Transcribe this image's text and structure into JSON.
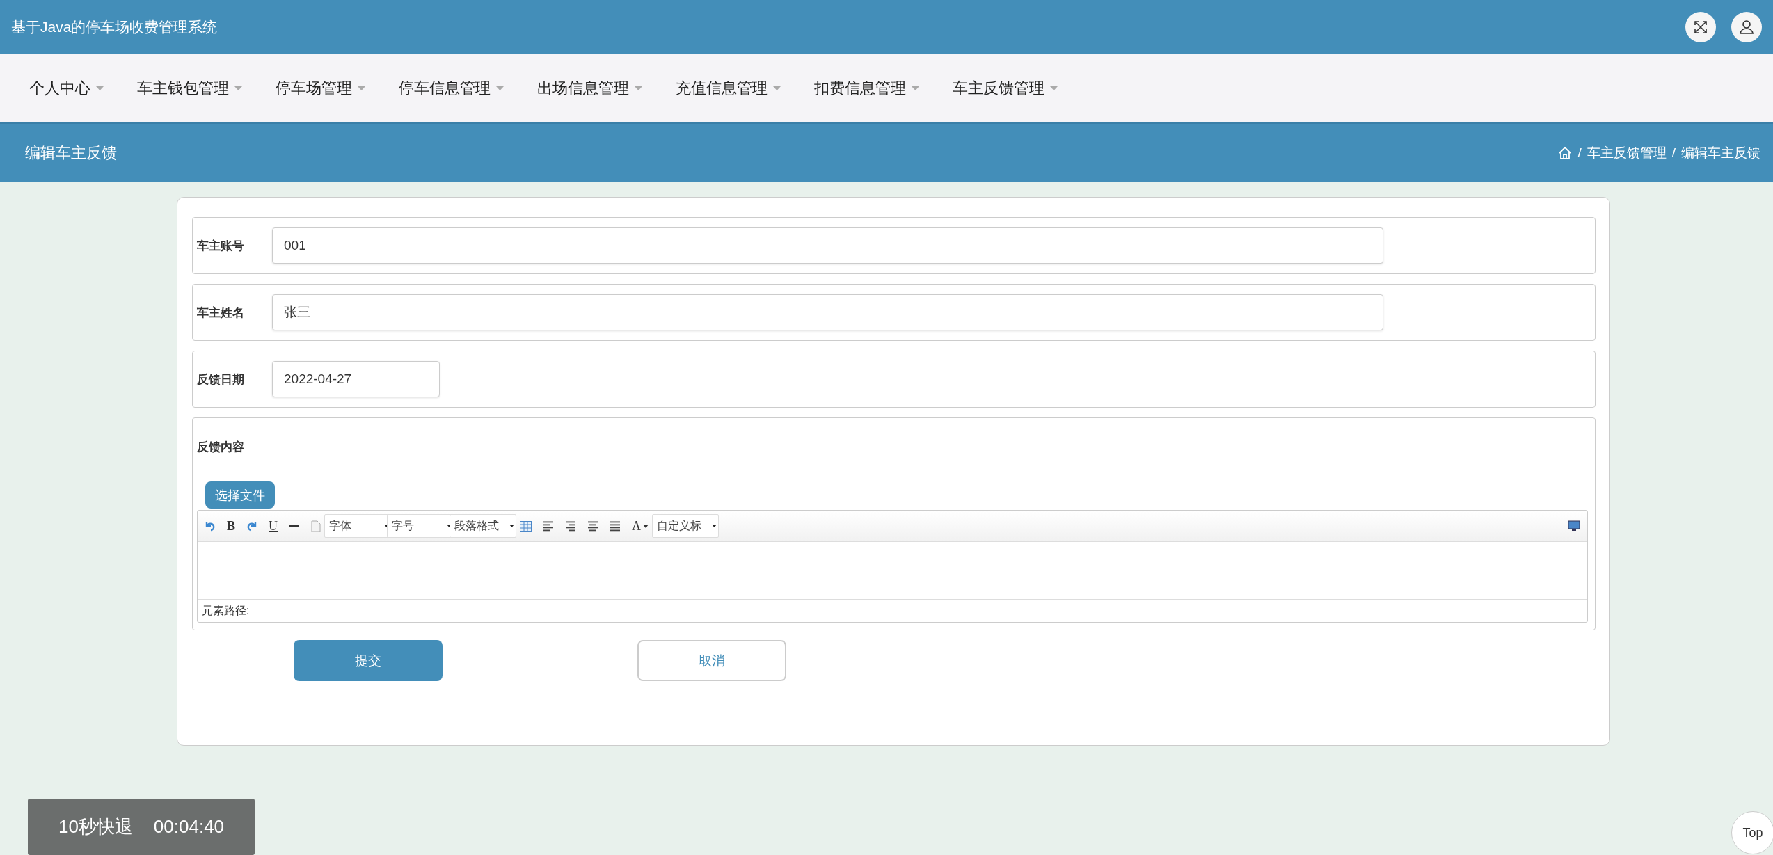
{
  "app_title": "基于Java的停车场收费管理系统",
  "nav": [
    {
      "label": "个人中心"
    },
    {
      "label": "车主钱包管理"
    },
    {
      "label": "停车场管理"
    },
    {
      "label": "停车信息管理"
    },
    {
      "label": "出场信息管理"
    },
    {
      "label": "充值信息管理"
    },
    {
      "label": "扣费信息管理"
    },
    {
      "label": "车主反馈管理"
    }
  ],
  "page_title": "编辑车主反馈",
  "breadcrumb": [
    "车主反馈管理",
    "编辑车主反馈"
  ],
  "breadcrumb_separator": "/",
  "fields": [
    {
      "label": "车主账号",
      "kind": "text",
      "value": "001"
    },
    {
      "label": "车主姓名",
      "kind": "text",
      "value": "张三"
    },
    {
      "label": "反馈日期",
      "kind": "date",
      "value": "2022-04-27"
    },
    {
      "label": "反馈内容",
      "kind": "editor"
    }
  ],
  "editor": {
    "upload_button": "选择文件",
    "path_label": "元素路径:",
    "toolbar": [
      {
        "kind": "undo"
      },
      {
        "kind": "bold",
        "text": "B"
      },
      {
        "kind": "redo"
      },
      {
        "kind": "underline",
        "text": "U"
      },
      {
        "kind": "rule"
      },
      {
        "kind": "page"
      },
      {
        "kind": "select",
        "text": "字体"
      },
      {
        "kind": "select",
        "text": "字号"
      },
      {
        "kind": "select",
        "text": "段落格式"
      },
      {
        "kind": "table"
      },
      {
        "kind": "align-left"
      },
      {
        "kind": "align-right"
      },
      {
        "kind": "align-center"
      },
      {
        "kind": "justify"
      },
      {
        "kind": "color",
        "text": "A"
      },
      {
        "kind": "select",
        "text": "自定义标"
      }
    ]
  },
  "buttons": [
    {
      "label": "提交",
      "kind": "primary"
    },
    {
      "label": "取消",
      "kind": "secondary"
    }
  ],
  "player": {
    "skip": "10秒快退",
    "time": "00:04:40"
  },
  "top_button": "Top"
}
